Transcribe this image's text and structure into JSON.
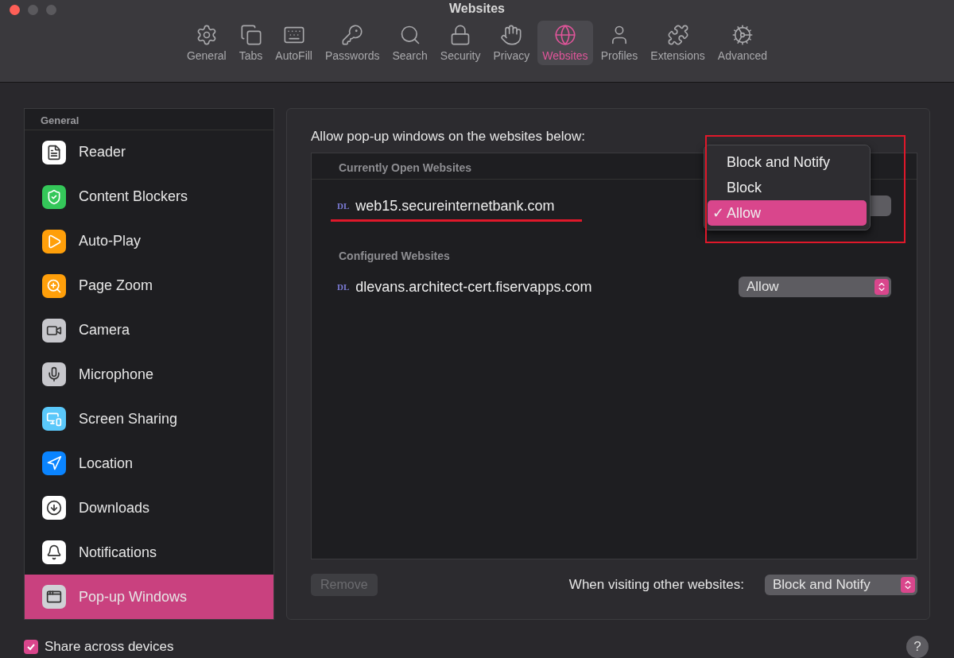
{
  "window": {
    "title": "Websites"
  },
  "toolbar": [
    {
      "label": "General",
      "selected": false
    },
    {
      "label": "Tabs",
      "selected": false
    },
    {
      "label": "AutoFill",
      "selected": false
    },
    {
      "label": "Passwords",
      "selected": false
    },
    {
      "label": "Search",
      "selected": false
    },
    {
      "label": "Security",
      "selected": false
    },
    {
      "label": "Privacy",
      "selected": false
    },
    {
      "label": "Websites",
      "selected": true
    },
    {
      "label": "Profiles",
      "selected": false
    },
    {
      "label": "Extensions",
      "selected": false
    },
    {
      "label": "Advanced",
      "selected": false
    }
  ],
  "sidebar": {
    "heading": "General",
    "items": [
      {
        "label": "Reader",
        "color": "#ffffff",
        "selected": false
      },
      {
        "label": "Content Blockers",
        "color": "#34c759",
        "selected": false
      },
      {
        "label": "Auto-Play",
        "color": "#ff9f0a",
        "selected": false
      },
      {
        "label": "Page Zoom",
        "color": "#ff9f0a",
        "selected": false
      },
      {
        "label": "Camera",
        "color": "#c7c7cc",
        "selected": false
      },
      {
        "label": "Microphone",
        "color": "#c7c7cc",
        "selected": false
      },
      {
        "label": "Screen Sharing",
        "color": "#5ac8fa",
        "selected": false
      },
      {
        "label": "Location",
        "color": "#0a84ff",
        "selected": false
      },
      {
        "label": "Downloads",
        "color": "#ffffff",
        "selected": false
      },
      {
        "label": "Notifications",
        "color": "#ffffff",
        "selected": false
      },
      {
        "label": "Pop-up Windows",
        "color": "#d0d0d5",
        "selected": true
      }
    ]
  },
  "main": {
    "intro": "Allow pop-up windows on the websites below:",
    "sections": [
      {
        "heading": "Currently Open Websites",
        "sites": [
          {
            "favicon": "DL",
            "domain": "web15.secureinternetbank.com",
            "underlined": true,
            "menu_open": true,
            "menu_options": [
              {
                "label": "Block and Notify",
                "selected": false
              },
              {
                "label": "Block",
                "selected": false
              },
              {
                "label": "Allow",
                "selected": true
              }
            ],
            "check": "✓"
          }
        ]
      },
      {
        "heading": "Configured Websites",
        "sites": [
          {
            "favicon": "DL",
            "domain": "dlevans.architect-cert.fiservapps.com",
            "setting": "Allow"
          }
        ]
      }
    ],
    "remove_button": {
      "label": "Remove",
      "disabled": true
    },
    "other_label": "When visiting other websites:",
    "other_setting": "Block and Notify"
  },
  "share": {
    "label": "Share across devices",
    "checked": true
  },
  "help": "?"
}
